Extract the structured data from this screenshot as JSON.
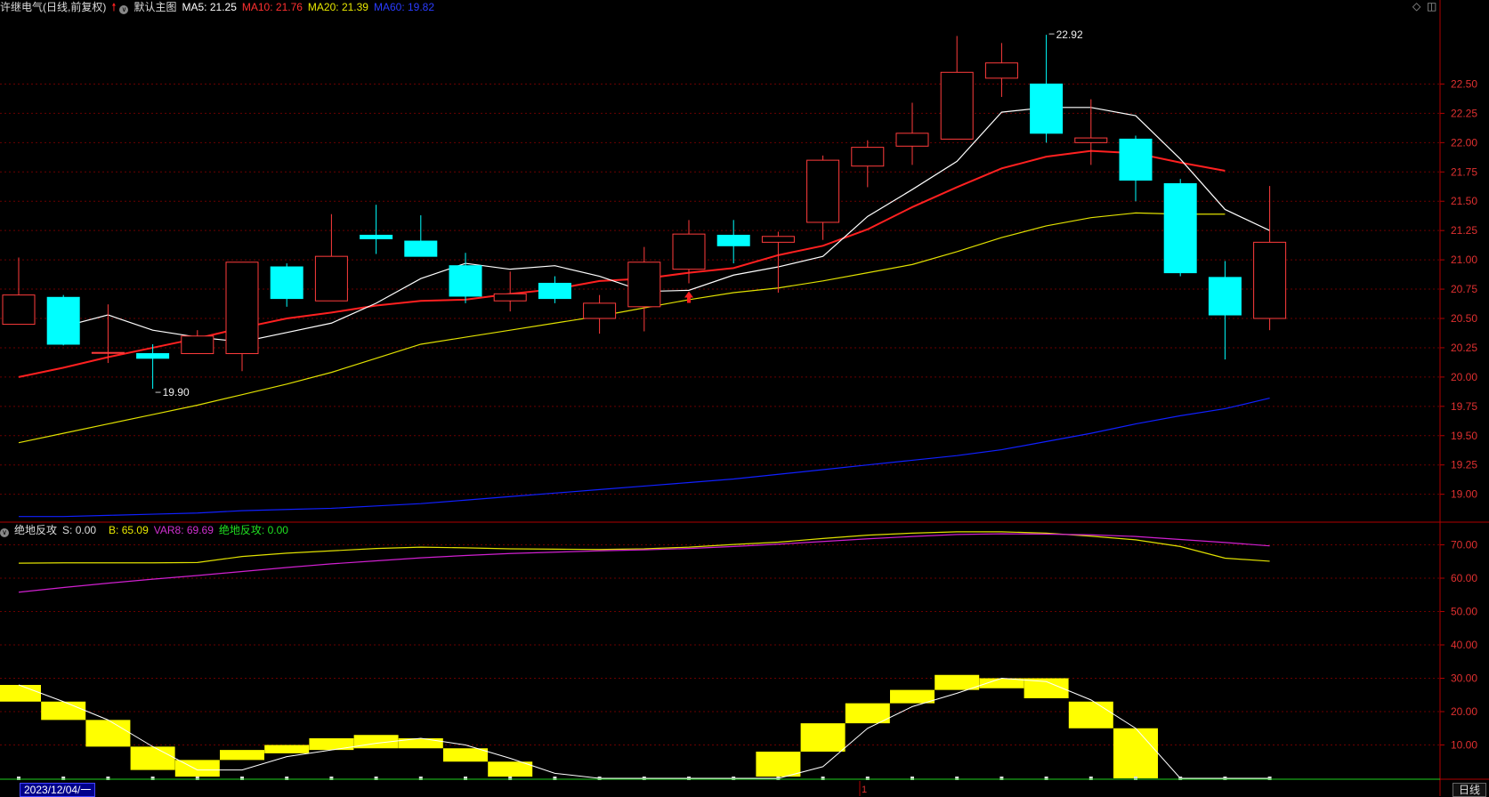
{
  "header": {
    "stock_title": "许继电气(日线,前复权)",
    "indicator_name": "默认主图",
    "ma5_label": "MA5: 21.25",
    "ma10_label": "MA10: 21.76",
    "ma20_label": "MA20: 21.39",
    "ma60_label": "MA60: 19.82"
  },
  "sub_header": {
    "name": "绝地反攻",
    "s_label": "S: 0.00",
    "b_label": "B: 65.09",
    "var8_label": "VAR8: 69.69",
    "jdfg_label": "绝地反攻: 0.00"
  },
  "footer": {
    "date": "2023/12/04/一",
    "marker": "1",
    "period": "日线"
  },
  "colors": {
    "up": "#ff3c3c",
    "down": "#00ffff",
    "ma5": "#ffffff",
    "ma10": "#ff2020",
    "ma20": "#e0e000",
    "ma60": "#1020ff",
    "b_line": "#e0e000",
    "var8_line": "#d020d0",
    "bars": "#ffff00",
    "axis": "#b00000"
  },
  "chart_data": [
    {
      "type": "candlestick",
      "y_ticks": [
        "22.50",
        "22.25",
        "22.00",
        "21.75",
        "21.50",
        "21.25",
        "21.00",
        "20.75",
        "20.50",
        "20.25",
        "20.00",
        "19.75",
        "19.50",
        "19.25",
        "19.00"
      ],
      "ylim": [
        18.8,
        23.05
      ],
      "grid": true,
      "candles": [
        {
          "o": 20.45,
          "h": 21.02,
          "l": 20.45,
          "c": 20.7
        },
        {
          "o": 20.68,
          "h": 20.7,
          "l": 20.27,
          "c": 20.28
        },
        {
          "o": 20.21,
          "h": 20.62,
          "l": 20.12,
          "c": 20.21
        },
        {
          "o": 20.2,
          "h": 20.28,
          "l": 19.9,
          "c": 20.16
        },
        {
          "o": 20.2,
          "h": 20.4,
          "l": 20.2,
          "c": 20.35
        },
        {
          "o": 20.2,
          "h": 20.98,
          "l": 20.05,
          "c": 20.98
        },
        {
          "o": 20.94,
          "h": 20.97,
          "l": 20.6,
          "c": 20.67
        },
        {
          "o": 20.65,
          "h": 21.39,
          "l": 20.65,
          "c": 21.03
        },
        {
          "o": 21.21,
          "h": 21.47,
          "l": 21.05,
          "c": 21.18
        },
        {
          "o": 21.16,
          "h": 21.38,
          "l": 21.03,
          "c": 21.03
        },
        {
          "o": 20.95,
          "h": 21.06,
          "l": 20.63,
          "c": 20.69
        },
        {
          "o": 20.65,
          "h": 20.9,
          "l": 20.56,
          "c": 20.71
        },
        {
          "o": 20.8,
          "h": 20.86,
          "l": 20.63,
          "c": 20.67
        },
        {
          "o": 20.5,
          "h": 20.7,
          "l": 20.37,
          "c": 20.63
        },
        {
          "o": 20.6,
          "h": 21.11,
          "l": 20.39,
          "c": 20.98
        },
        {
          "o": 20.92,
          "h": 21.34,
          "l": 20.8,
          "c": 21.22
        },
        {
          "o": 21.21,
          "h": 21.34,
          "l": 20.97,
          "c": 21.12
        },
        {
          "o": 21.15,
          "h": 21.24,
          "l": 20.72,
          "c": 21.2
        },
        {
          "o": 21.32,
          "h": 21.89,
          "l": 21.17,
          "c": 21.85
        },
        {
          "o": 21.8,
          "h": 22.02,
          "l": 21.62,
          "c": 21.96
        },
        {
          "o": 21.97,
          "h": 22.34,
          "l": 21.81,
          "c": 22.08
        },
        {
          "o": 22.03,
          "h": 22.91,
          "l": 22.03,
          "c": 22.6
        },
        {
          "o": 22.55,
          "h": 22.85,
          "l": 22.39,
          "c": 22.68
        },
        {
          "o": 22.5,
          "h": 22.92,
          "l": 22.0,
          "c": 22.08
        },
        {
          "o": 22.0,
          "h": 22.37,
          "l": 21.81,
          "c": 22.04
        },
        {
          "o": 22.03,
          "h": 22.06,
          "l": 21.5,
          "c": 21.68
        },
        {
          "o": 21.65,
          "h": 21.69,
          "l": 20.86,
          "c": 20.89
        },
        {
          "o": 20.85,
          "h": 20.99,
          "l": 20.15,
          "c": 20.53
        },
        {
          "o": 20.5,
          "h": 21.63,
          "l": 20.4,
          "c": 21.15
        }
      ],
      "ma5": [
        20.43,
        20.53,
        20.4,
        20.34,
        20.3,
        20.38,
        20.46,
        20.63,
        20.84,
        20.97,
        20.92,
        20.95,
        20.86,
        20.73,
        20.74,
        20.87,
        20.94,
        21.03,
        21.37,
        21.6,
        21.84,
        22.26,
        22.3,
        22.3,
        22.23,
        21.86,
        21.43,
        21.25
      ],
      "ma10": [
        20.0,
        20.08,
        20.17,
        20.25,
        20.33,
        20.42,
        20.5,
        20.55,
        20.61,
        20.65,
        20.66,
        20.71,
        20.75,
        20.82,
        20.84,
        20.89,
        20.93,
        21.04,
        21.12,
        21.26,
        21.45,
        21.62,
        21.78,
        21.88,
        21.93,
        21.91,
        21.83,
        21.76
      ],
      "ma20": [
        19.44,
        19.52,
        19.6,
        19.68,
        19.76,
        19.85,
        19.94,
        20.04,
        20.16,
        20.28,
        20.34,
        20.4,
        20.46,
        20.52,
        20.59,
        20.66,
        20.72,
        20.76,
        20.82,
        20.89,
        20.96,
        21.07,
        21.19,
        21.29,
        21.36,
        21.4,
        21.39,
        21.39
      ],
      "ma60": [
        18.81,
        18.81,
        18.82,
        18.83,
        18.84,
        18.86,
        18.87,
        18.88,
        18.9,
        18.92,
        18.95,
        18.98,
        19.01,
        19.04,
        19.07,
        19.1,
        19.13,
        19.17,
        19.21,
        19.25,
        19.29,
        19.33,
        19.38,
        19.45,
        19.52,
        19.6,
        19.67,
        19.73,
        19.82
      ],
      "annotations": [
        {
          "label": "19.90",
          "candle": 3,
          "value": 19.9
        },
        {
          "label": "22.92",
          "candle": 23,
          "value": 22.92
        }
      ],
      "signals": [
        {
          "candle": 15,
          "direction": "up"
        }
      ]
    },
    {
      "type": "bar",
      "name": "绝地反攻",
      "y_ticks": [
        "70.00",
        "60.00",
        "50.00",
        "40.00",
        "30.00",
        "20.00",
        "10.00"
      ],
      "ylim": [
        0,
        76
      ],
      "grid": true,
      "b": [
        64.5,
        64.6,
        64.6,
        64.6,
        64.7,
        66.5,
        67.5,
        68.2,
        68.9,
        69.3,
        69.1,
        68.8,
        68.7,
        68.6,
        68.8,
        69.3,
        70.1,
        70.8,
        71.9,
        72.9,
        73.5,
        73.9,
        73.9,
        73.5,
        72.6,
        71.5,
        69.5,
        66.0,
        65.09
      ],
      "var8": [
        55.8,
        57.2,
        58.5,
        59.7,
        60.8,
        62.0,
        63.2,
        64.3,
        65.2,
        66.1,
        66.8,
        67.4,
        67.8,
        68.2,
        68.5,
        68.9,
        69.5,
        70.2,
        71.0,
        71.8,
        72.5,
        73.1,
        73.3,
        73.2,
        73.0,
        72.5,
        71.6,
        70.7,
        69.69
      ],
      "var": [
        28.0,
        23.0,
        17.5,
        9.5,
        2.5,
        2.5,
        6.5,
        8.5,
        10.5,
        12.0,
        10.0,
        6.0,
        1.5,
        0.0,
        0.0,
        0.0,
        0.0,
        0.0,
        3.5,
        15.0,
        21.5,
        25.5,
        30.0,
        29.0,
        23.5,
        15.0,
        0.0,
        0.0,
        0.0
      ],
      "bars": [
        {
          "from": 28.0,
          "to": 23.0
        },
        {
          "from": 23.0,
          "to": 17.5
        },
        {
          "from": 17.5,
          "to": 9.5
        },
        {
          "from": 9.5,
          "to": 2.5
        },
        {
          "from": 5.5,
          "to": 0.5
        },
        {
          "from": 8.5,
          "to": 5.5
        },
        {
          "from": 10.0,
          "to": 7.5
        },
        {
          "from": 12.0,
          "to": 8.5
        },
        {
          "from": 13.0,
          "to": 9.0
        },
        {
          "from": 12.0,
          "to": 9.0
        },
        {
          "from": 9.0,
          "to": 5.0
        },
        {
          "from": 5.0,
          "to": 0.5
        },
        {
          "from": 0,
          "to": 0
        },
        {
          "from": 0,
          "to": 0
        },
        {
          "from": 0,
          "to": 0
        },
        {
          "from": 0,
          "to": 0
        },
        {
          "from": 0,
          "to": 0
        },
        {
          "from": 0.5,
          "to": 8.0
        },
        {
          "from": 8.0,
          "to": 16.5
        },
        {
          "from": 16.5,
          "to": 22.5
        },
        {
          "from": 22.5,
          "to": 26.5
        },
        {
          "from": 26.5,
          "to": 31.0
        },
        {
          "from": 27.0,
          "to": 30.0
        },
        {
          "from": 30.0,
          "to": 24.0
        },
        {
          "from": 23.0,
          "to": 15.0
        },
        {
          "from": 15.0,
          "to": 0.0
        }
      ]
    }
  ]
}
